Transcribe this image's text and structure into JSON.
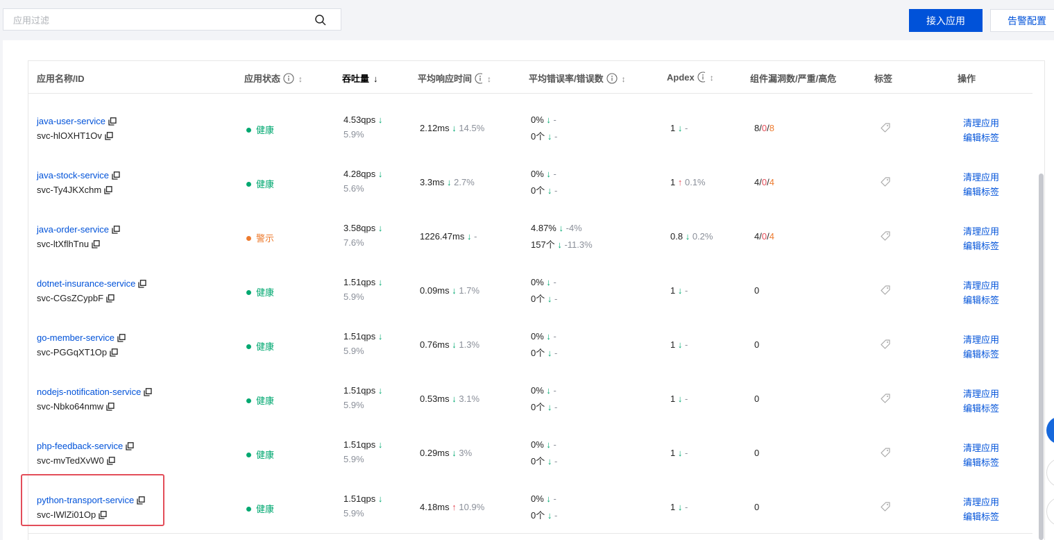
{
  "toolbar": {
    "search_placeholder": "应用过滤",
    "connect_label": "接入应用",
    "alarm_label": "告警配置"
  },
  "colors": {
    "primary": "#0052d9",
    "healthy": "#00a870",
    "warning": "#ed7b2f",
    "danger": "#e34d59"
  },
  "table": {
    "headers": {
      "name": "应用名称/ID",
      "status": "应用状态",
      "throughput": "吞吐量",
      "avg_response": "平均响应时间",
      "error_rate": "平均错误率/错误数",
      "apdex": "Apdex",
      "vuln": "组件漏洞数/严重/高危",
      "tags": "标签",
      "ops": "操作"
    },
    "rows": [
      {
        "name": "java-user-service",
        "id": "svc-hlOXHT1Ov",
        "status": "健康",
        "status_type": "healthy",
        "qps": "4.53qps",
        "qps_change": "5.9%",
        "resp": "2.12ms",
        "resp_dir": "down",
        "resp_change": "14.5%",
        "err_rate": "0%",
        "err_rate_change": "-",
        "err_count": "0个",
        "err_count_change": "-",
        "apdex": "1",
        "apdex_dir": "down",
        "apdex_change": "-",
        "vuln_total": "8",
        "vuln_critical": "0",
        "vuln_high": "8",
        "op_clean": "清理应用",
        "op_edit": "编辑标签"
      },
      {
        "name": "java-stock-service",
        "id": "svc-Ty4JKXchm",
        "status": "健康",
        "status_type": "healthy",
        "qps": "4.28qps",
        "qps_change": "5.6%",
        "resp": "3.3ms",
        "resp_dir": "down",
        "resp_change": "2.7%",
        "err_rate": "0%",
        "err_rate_change": "-",
        "err_count": "0个",
        "err_count_change": "-",
        "apdex": "1",
        "apdex_dir": "up",
        "apdex_change": "0.1%",
        "vuln_total": "4",
        "vuln_critical": "0",
        "vuln_high": "4",
        "op_clean": "清理应用",
        "op_edit": "编辑标签"
      },
      {
        "name": "java-order-service",
        "id": "svc-ltXflhTnu",
        "status": "警示",
        "status_type": "warning",
        "qps": "3.58qps",
        "qps_change": "7.6%",
        "resp": "1226.47ms",
        "resp_dir": "down",
        "resp_change": "-",
        "err_rate": "4.87%",
        "err_rate_change": "-4%",
        "err_count": "157个",
        "err_count_change": "-11.3%",
        "apdex": "0.8",
        "apdex_dir": "down",
        "apdex_change": "0.2%",
        "vuln_total": "4",
        "vuln_critical": "0",
        "vuln_high": "4",
        "op_clean": "清理应用",
        "op_edit": "编辑标签"
      },
      {
        "name": "dotnet-insurance-service",
        "id": "svc-CGsZCypbF",
        "status": "健康",
        "status_type": "healthy",
        "qps": "1.51qps",
        "qps_change": "5.9%",
        "resp": "0.09ms",
        "resp_dir": "down",
        "resp_change": "1.7%",
        "err_rate": "0%",
        "err_rate_change": "-",
        "err_count": "0个",
        "err_count_change": "-",
        "apdex": "1",
        "apdex_dir": "down",
        "apdex_change": "-",
        "vuln_total": "0",
        "op_clean": "清理应用",
        "op_edit": "编辑标签"
      },
      {
        "name": "go-member-service",
        "id": "svc-PGGqXT1Op",
        "status": "健康",
        "status_type": "healthy",
        "qps": "1.51qps",
        "qps_change": "5.9%",
        "resp": "0.76ms",
        "resp_dir": "down",
        "resp_change": "1.3%",
        "err_rate": "0%",
        "err_rate_change": "-",
        "err_count": "0个",
        "err_count_change": "-",
        "apdex": "1",
        "apdex_dir": "down",
        "apdex_change": "-",
        "vuln_total": "0",
        "op_clean": "清理应用",
        "op_edit": "编辑标签"
      },
      {
        "name": "nodejs-notification-service",
        "id": "svc-Nbko64nmw",
        "status": "健康",
        "status_type": "healthy",
        "qps": "1.51qps",
        "qps_change": "5.9%",
        "resp": "0.53ms",
        "resp_dir": "down",
        "resp_change": "3.1%",
        "err_rate": "0%",
        "err_rate_change": "-",
        "err_count": "0个",
        "err_count_change": "-",
        "apdex": "1",
        "apdex_dir": "down",
        "apdex_change": "-",
        "vuln_total": "0",
        "op_clean": "清理应用",
        "op_edit": "编辑标签"
      },
      {
        "name": "php-feedback-service",
        "id": "svc-mvTedXvW0",
        "status": "健康",
        "status_type": "healthy",
        "qps": "1.51qps",
        "qps_change": "5.9%",
        "resp": "0.29ms",
        "resp_dir": "down",
        "resp_change": "3%",
        "err_rate": "0%",
        "err_rate_change": "-",
        "err_count": "0个",
        "err_count_change": "-",
        "apdex": "1",
        "apdex_dir": "down",
        "apdex_change": "-",
        "vuln_total": "0",
        "op_clean": "清理应用",
        "op_edit": "编辑标签"
      },
      {
        "name": "python-transport-service",
        "id": "svc-IWlZi01Op",
        "status": "健康",
        "status_type": "healthy",
        "qps": "1.51qps",
        "qps_change": "5.9%",
        "resp": "4.18ms",
        "resp_dir": "up",
        "resp_change": "10.9%",
        "err_rate": "0%",
        "err_rate_change": "-",
        "err_count": "0个",
        "err_count_change": "-",
        "apdex": "1",
        "apdex_dir": "down",
        "apdex_change": "-",
        "vuln_total": "0",
        "op_clean": "清理应用",
        "op_edit": "编辑标签"
      }
    ]
  }
}
